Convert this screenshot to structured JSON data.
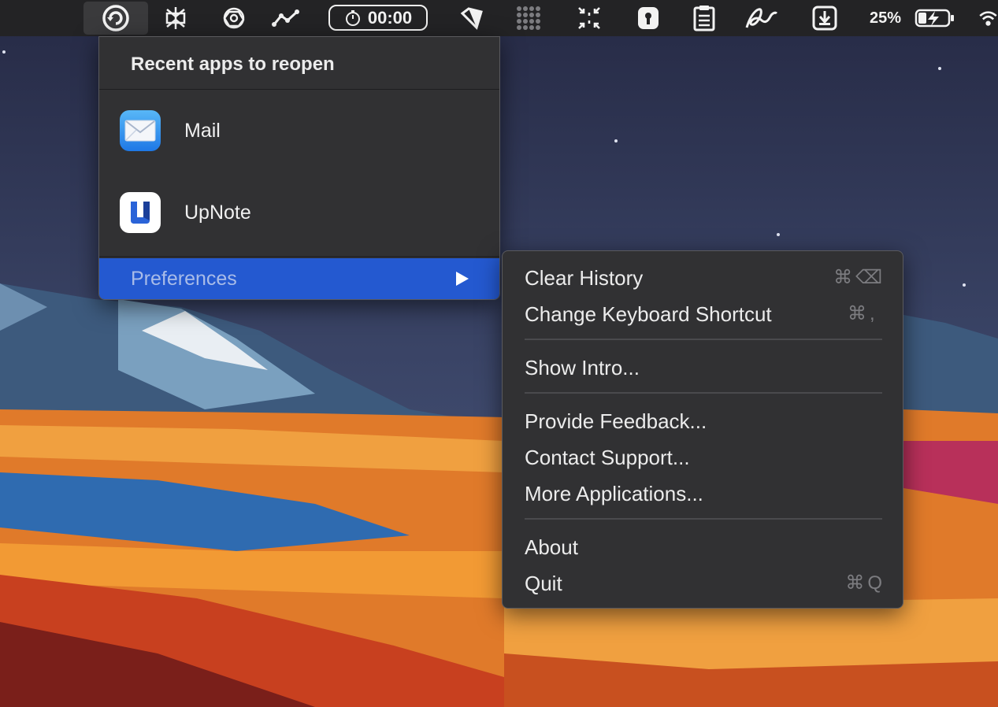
{
  "menubar": {
    "icons": [
      "reopen-app-icon",
      "perplexity-icon",
      "chatgpt-icon",
      "activity-graph-icon",
      "timer-icon",
      "bookmark-tag-icon",
      "grid-dots-icon",
      "arrows-collapse-icon",
      "keyhole-lock-icon",
      "clipboard-icon",
      "signature-icon",
      "download-box-icon",
      "battery-charging-icon",
      "wifi-icon"
    ],
    "timer_value": "00:00",
    "battery_percent": "25%"
  },
  "recent_menu": {
    "header": "Recent apps to reopen",
    "apps": [
      {
        "name": "Mail",
        "icon": "mail-app-icon"
      },
      {
        "name": "UpNote",
        "icon": "upnote-app-icon"
      }
    ],
    "preferences_label": "Preferences"
  },
  "preferences_submenu": {
    "items": [
      {
        "label": "Clear History",
        "shortcut_key": "⌫",
        "shortcut_mod": "⌘"
      },
      {
        "label": "Change Keyboard Shortcut",
        "shortcut_key": ",",
        "shortcut_mod": "⌘"
      },
      {
        "label": "Show Intro..."
      },
      {
        "label": "Provide Feedback..."
      },
      {
        "label": "Contact Support..."
      },
      {
        "label": "More Applications..."
      },
      {
        "label": "About"
      },
      {
        "label": "Quit",
        "shortcut_key": "Q",
        "shortcut_mod": "⌘"
      }
    ]
  },
  "colors": {
    "menu_bg": "#313133",
    "highlight": "#2459d0",
    "menubar_bg": "#232325"
  }
}
